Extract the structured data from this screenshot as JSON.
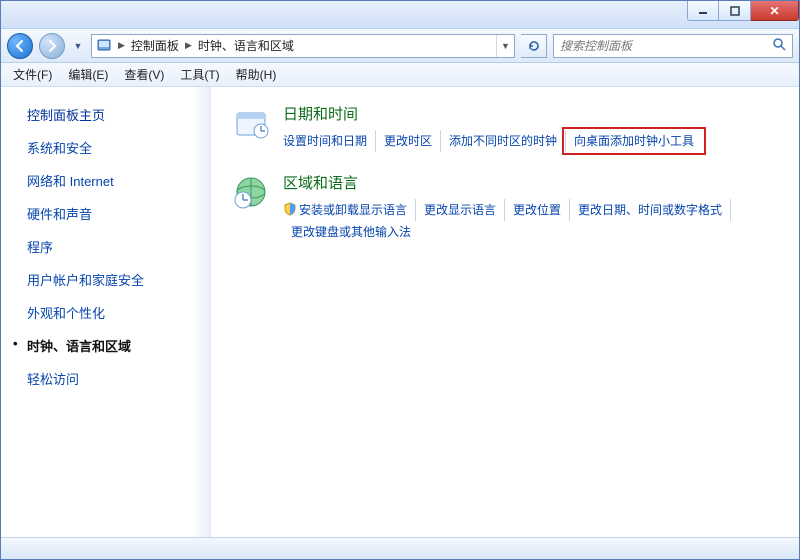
{
  "titlebar": {
    "min": "—",
    "max": "❐",
    "close": "✕"
  },
  "nav": {
    "back": "←",
    "forward": "→"
  },
  "breadcrumb": {
    "root_glyph": "▸",
    "level1": "控制面板",
    "level2": "时钟、语言和区域"
  },
  "search": {
    "placeholder": "搜索控制面板"
  },
  "menubar": {
    "file": "文件(F)",
    "edit": "编辑(E)",
    "view": "查看(V)",
    "tools": "工具(T)",
    "help": "帮助(H)"
  },
  "sidebar": {
    "heading": "控制面板主页",
    "items": [
      "系统和安全",
      "网络和 Internet",
      "硬件和声音",
      "程序",
      "用户帐户和家庭安全",
      "外观和个性化",
      "时钟、语言和区域",
      "轻松访问"
    ],
    "active_index": 6
  },
  "sections": [
    {
      "title": "日期和时间",
      "links": [
        "设置时间和日期",
        "更改时区",
        "添加不同时区的时钟",
        "向桌面添加时钟小工具"
      ]
    },
    {
      "title": "区域和语言",
      "links": [
        "安装或卸载显示语言",
        "更改显示语言",
        "更改位置",
        "更改日期、时间或数字格式",
        "更改键盘或其他输入法"
      ],
      "shield_indices": [
        0
      ]
    }
  ],
  "highlight_link": "向桌面添加时钟小工具"
}
